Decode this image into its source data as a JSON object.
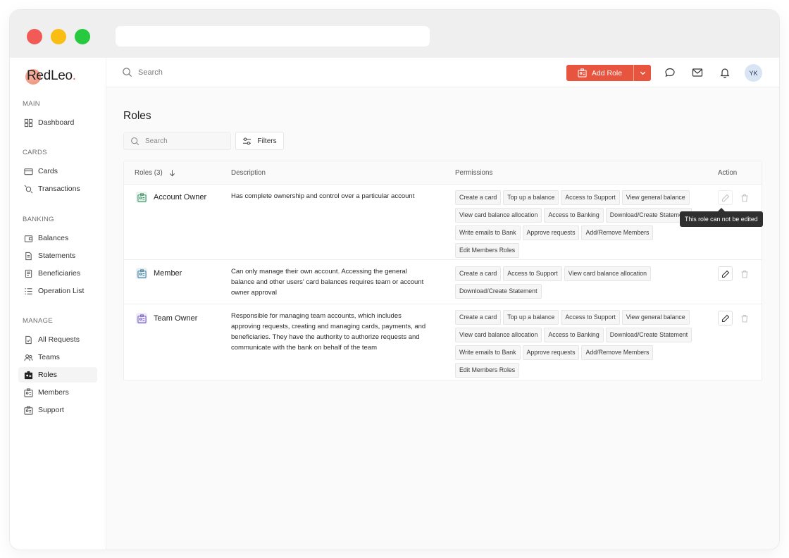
{
  "app": {
    "logo_text": "RedLeo",
    "logo_dot": "."
  },
  "sidebar": {
    "sections": [
      {
        "title": "MAIN",
        "items": [
          {
            "label": "Dashboard",
            "icon": "grid-icon"
          }
        ]
      },
      {
        "title": "CARDS",
        "items": [
          {
            "label": "Cards",
            "icon": "card-icon"
          },
          {
            "label": "Transactions",
            "icon": "transactions-icon"
          }
        ]
      },
      {
        "title": "BANKING",
        "items": [
          {
            "label": "Balances",
            "icon": "wallet-icon"
          },
          {
            "label": "Statements",
            "icon": "document-icon"
          },
          {
            "label": "Beneficiaries",
            "icon": "beneficiaries-icon"
          },
          {
            "label": "Operation List",
            "icon": "list-icon"
          }
        ]
      },
      {
        "title": "MANAGE",
        "items": [
          {
            "label": "All Requests",
            "icon": "requests-icon"
          },
          {
            "label": "Teams",
            "icon": "teams-icon"
          },
          {
            "label": "Roles",
            "icon": "roles-icon",
            "active": true
          },
          {
            "label": "Members",
            "icon": "members-icon"
          },
          {
            "label": "Support",
            "icon": "support-icon"
          }
        ]
      }
    ]
  },
  "topbar": {
    "search_placeholder": "Search",
    "add_role_label": "Add Role",
    "avatar_initials": "YK"
  },
  "page": {
    "title": "Roles",
    "search_placeholder": "Search",
    "filters_label": "Filters"
  },
  "table": {
    "headers": {
      "roles": "Roles (3)",
      "description": "Description",
      "permissions": "Permissions",
      "action": "Action"
    },
    "rows": [
      {
        "name": "Account Owner",
        "icon_color": "#3a8a63",
        "description": "Has complete ownership and control over a particular account",
        "permissions": [
          "Create a card",
          "Top up a balance",
          "Access to Support",
          "View general balance",
          "View card balance allocation",
          "Access to Banking",
          "Download/Create Statement",
          "Write emails to Bank",
          "Approve requests",
          "Add/Remove Members",
          "Edit Members Roles"
        ],
        "editable": false
      },
      {
        "name": "Member",
        "icon_color": "#3d7a96",
        "description": "Can only manage their own account. Accessing the general balance and other users' card balances requires team or account owner approval",
        "permissions": [
          "Create a card",
          "Access to Support",
          "View card balance allocation",
          "Download/Create Statement"
        ],
        "editable": true
      },
      {
        "name": "Team Owner",
        "icon_color": "#6f57b8",
        "description": "Responsible for managing team accounts, which includes approving requests, creating and managing cards, payments, and beneficiaries. They have the authority to authorize requests and communicate with the bank on behalf of the team",
        "permissions": [
          "Create a card",
          "Top up a balance",
          "Access to Support",
          "View general balance",
          "View card balance allocation",
          "Access to Banking",
          "Download/Create Statement",
          "Write emails to Bank",
          "Approve requests",
          "Add/Remove Members",
          "Edit Members Roles"
        ],
        "editable": true
      }
    ],
    "tooltip": "This role can not be edited"
  }
}
